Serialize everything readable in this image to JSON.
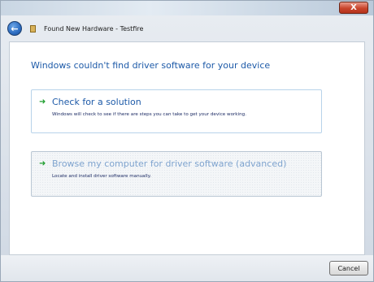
{
  "window": {
    "close_symbol": "X",
    "title": "Found New Hardware - Testfire"
  },
  "icons": {
    "back": "arrow-left",
    "hardware": "hardware-device",
    "option_arrow": "green-arrow"
  },
  "main": {
    "heading": "Windows couldn't find driver software for your device",
    "options": [
      {
        "title": "Check for a solution",
        "description": "Windows will check to see if there are steps you can take to get your device working."
      },
      {
        "title": "Browse my computer for driver software (advanced)",
        "description": "Locate and install driver software manually."
      }
    ]
  },
  "footer": {
    "cancel_label": "Cancel"
  },
  "colors": {
    "heading_blue": "#1d5aa8",
    "disabled_blue": "#7fa4cf",
    "arrow_green": "#1f9e2f"
  }
}
